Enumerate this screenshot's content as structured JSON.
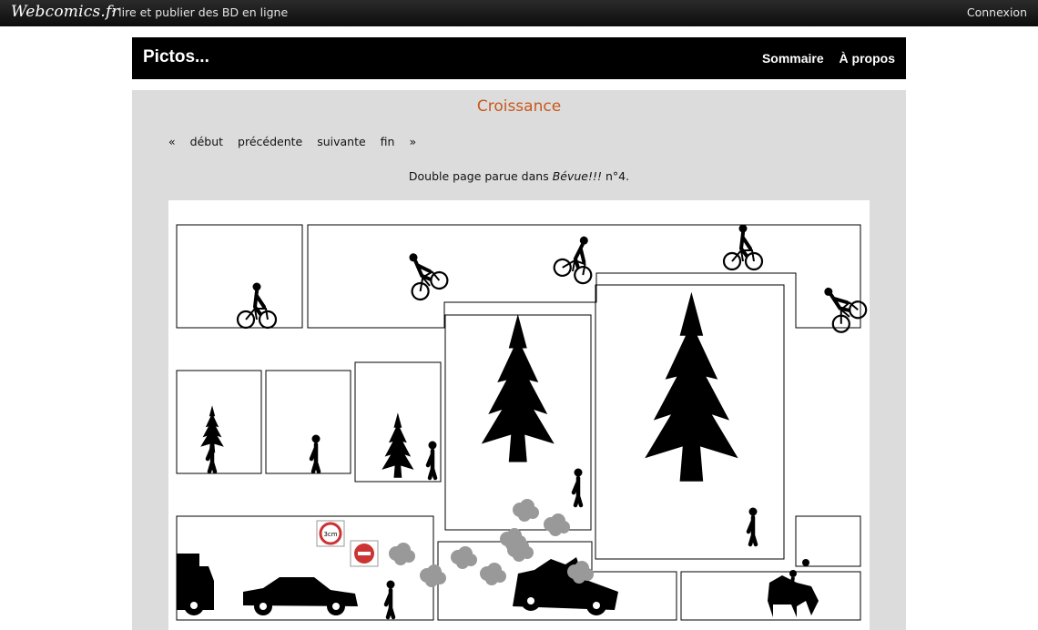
{
  "topbar": {
    "logo": "Webcomics.fr",
    "tagline": ": lire et publier des BD en ligne",
    "login": "Connexion"
  },
  "header": {
    "site_title": "Pictos...",
    "nav": [
      "Sommaire",
      "À propos"
    ]
  },
  "page": {
    "title": "Croissance",
    "pager": {
      "first_arrow": "«",
      "first": "début",
      "prev": "précédente",
      "next": "suivante",
      "last": "fin",
      "last_arrow": "»"
    },
    "caption": {
      "before": "Double page parue dans ",
      "magazine": "Bévue!!!",
      "after": " n°4."
    }
  },
  "comic": {
    "sign_label": "3cm"
  },
  "colors": {
    "accent": "#c8581c",
    "panel_bg": "#dcdcdc",
    "header_bg": "#000000"
  }
}
